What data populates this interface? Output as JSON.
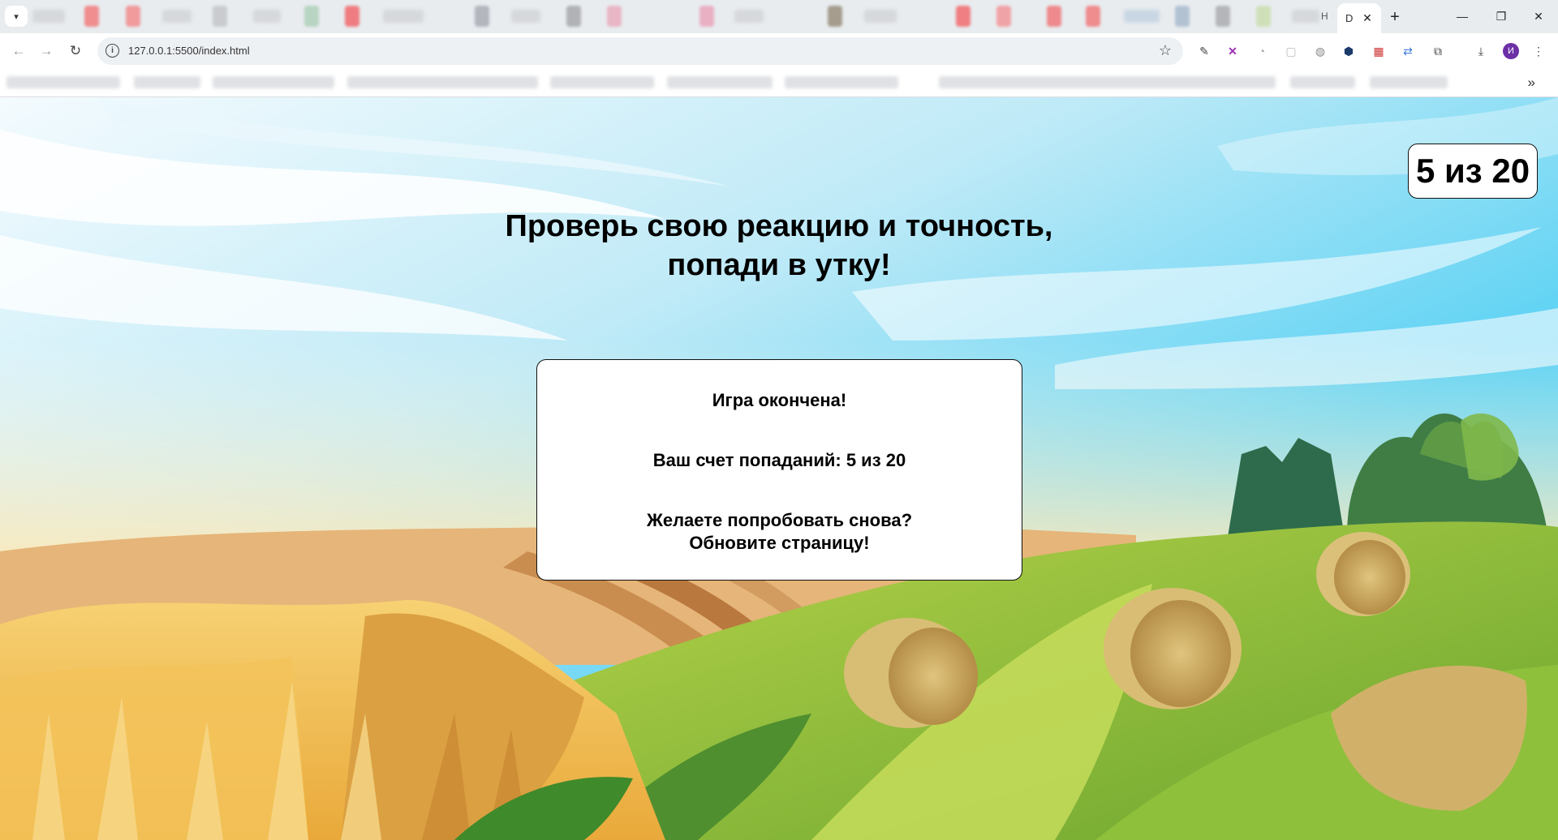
{
  "browser": {
    "active_tab_label": "D",
    "inactive_tab_partial_label": "H",
    "url": "127.0.0.1:5500/index.html",
    "profile_initial": "И"
  },
  "page": {
    "counter": "5 из 20",
    "headline_line1": "Проверь свою реакцию и точность,",
    "headline_line2": "попади в утку!",
    "modal": {
      "game_over": "Игра окончена!",
      "score": "Ваш счет попаданий: 5 из 20",
      "retry_line1": "Желаете попробовать снова?",
      "retry_line2": "Обновите страницу!"
    }
  },
  "colors": {
    "sky_top": "#33c8f5",
    "field_green": "#9cc43a",
    "wheat": "#f2c24a",
    "hay": "#c9ab5f"
  }
}
